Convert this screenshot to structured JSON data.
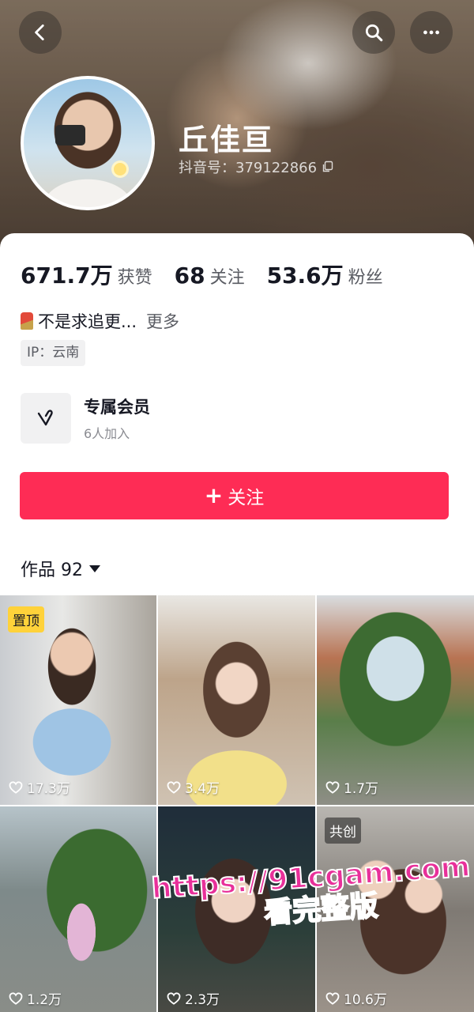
{
  "header": {
    "back_icon": "chevron-left-icon",
    "search_icon": "search-icon",
    "more_icon": "more-horizontal-icon"
  },
  "profile": {
    "name": "丘佳亘",
    "douyin_id": "抖音号：379122866",
    "copy_icon": "copy-icon"
  },
  "stats": [
    {
      "value": "671.7万",
      "label": "获赞"
    },
    {
      "value": "68",
      "label": "关注"
    },
    {
      "value": "53.6万",
      "label": "粉丝"
    }
  ],
  "bio": {
    "text": "不是求追更...",
    "more": "更多"
  },
  "ip": "IP：云南",
  "member": {
    "title": "专属会员",
    "subtitle": "6人加入"
  },
  "follow_button": {
    "label": "关注",
    "color": "#fe2c55"
  },
  "works_tab": {
    "label": "作品 92"
  },
  "videos": [
    {
      "likes": "17.3万",
      "badge": "置顶"
    },
    {
      "likes": "3.4万",
      "badge": ""
    },
    {
      "likes": "1.7万",
      "badge": ""
    },
    {
      "likes": "1.2万",
      "badge": ""
    },
    {
      "likes": "2.3万",
      "badge": ""
    },
    {
      "likes": "10.6万",
      "badge": "共创"
    }
  ],
  "watermark": {
    "line1": "https://91cgam.com",
    "line2": "看完整版"
  }
}
